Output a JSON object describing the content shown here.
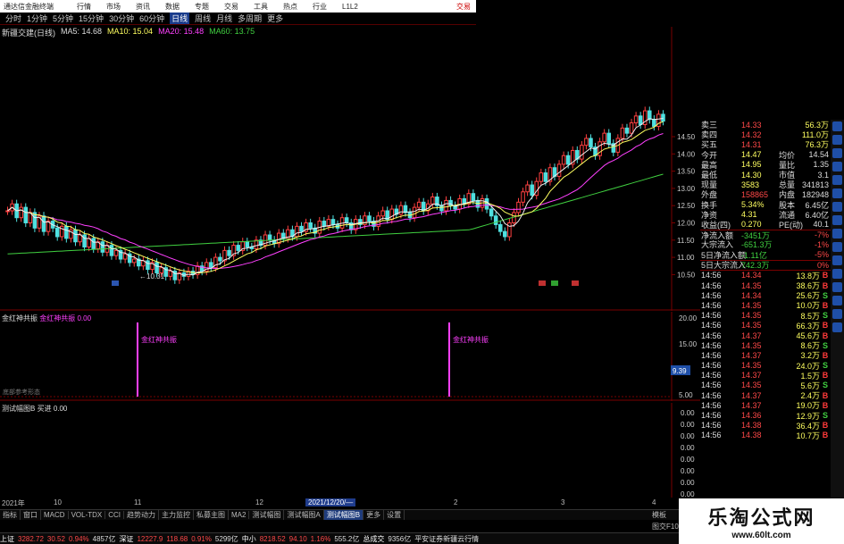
{
  "menubar": {
    "title": "通达信金融终端",
    "items": [
      "行情",
      "市场",
      "资讯",
      "数据",
      "专题",
      "交易",
      "工具",
      "热点",
      "行业",
      "L1L2"
    ],
    "right": "交易"
  },
  "toolbar": {
    "items": [
      "分时",
      "1分钟",
      "5分钟",
      "15分钟",
      "30分钟",
      "60分钟",
      "日线",
      "周线",
      "月线",
      "多周期",
      "更多"
    ],
    "active": "日线"
  },
  "main_chart": {
    "stock_label": "新疆交建(日线)",
    "ma5": "MA5: 14.68",
    "ma10": "MA10: 15.04",
    "ma20": "MA20: 15.48",
    "ma60": "MA60: 13.75",
    "low_label": "←10.31",
    "colors": {
      "up": "#ff4040",
      "down": "#4fe0e0",
      "ma5": "#ffffff",
      "ma10": "#ffff60",
      "ma20": "#ff40ff",
      "ma60": "#40d040"
    },
    "y_ticks": [
      "14.50",
      "14.00",
      "13.50",
      "13.00",
      "12.50",
      "12.00",
      "11.50",
      "11.00",
      "10.50"
    ]
  },
  "ind1": {
    "title": "金红神共振",
    "name2": "金红神共振",
    "value": "0.00",
    "signal_label": "金红神共振",
    "bottom_label": "底部参考形态",
    "y_ticks": [
      "20.00",
      "15.00",
      "9.39",
      "5.00"
    ]
  },
  "ind2": {
    "title": "测试幅图B",
    "name2": "买进",
    "value": "0.00",
    "y_ticks": [
      "0.00",
      "0.00",
      "0.00",
      "0.00",
      "0.00",
      "0.00",
      "0.00",
      "0.00"
    ]
  },
  "dates": {
    "y2021": "2021年",
    "m10": "10",
    "m11": "11",
    "m12": "12",
    "sel": "2021/12/20/—",
    "m1": "2",
    "m2": "3",
    "m3": "4"
  },
  "quote": {
    "sell4": [
      "卖四",
      "14.32",
      "111.0万"
    ],
    "sell3": [
      "卖三",
      "14.33",
      "56.3万"
    ],
    "sell5": [
      "买五",
      "14.31",
      "76.3万"
    ],
    "rows": [
      [
        "今开",
        "14.47",
        "均价",
        "14.54"
      ],
      [
        "最高",
        "14.95",
        "量比",
        "1.35"
      ],
      [
        "最低",
        "14.30",
        "市值",
        "3.1"
      ],
      [
        "现量",
        "3583",
        "总量",
        "341813"
      ],
      [
        "外盘",
        "158865",
        "内盘",
        "182948"
      ],
      [
        "换手",
        "5.34%",
        "股本",
        "6.45亿"
      ],
      [
        "净资",
        "4.31",
        "流通",
        "6.40亿"
      ],
      [
        "收益(四)",
        "0.270",
        "PE(动)",
        "40.1"
      ],
      [
        "净流入额",
        "-3451万",
        "",
        "-7%"
      ],
      [
        "大宗流入",
        "-651.3万",
        "",
        "-1%"
      ],
      [
        "5日净流入额",
        "-1.11亿",
        "",
        "-5%"
      ],
      [
        "5日大宗流入",
        "742.3万",
        "",
        "0%"
      ]
    ]
  },
  "ticks": [
    [
      "14:56",
      "14.34",
      "13.8万",
      "B"
    ],
    [
      "14:56",
      "14.35",
      "38.6万",
      "B"
    ],
    [
      "14:56",
      "14.34",
      "25.6万",
      "S"
    ],
    [
      "14:56",
      "14.35",
      "10.0万",
      "B"
    ],
    [
      "14:56",
      "14.35",
      "8.5万",
      "S"
    ],
    [
      "14:56",
      "14.35",
      "66.3万",
      "B"
    ],
    [
      "14:56",
      "14.37",
      "45.6万",
      "B"
    ],
    [
      "14:56",
      "14.35",
      "8.6万",
      "S"
    ],
    [
      "14:56",
      "14.37",
      "3.2万",
      "B"
    ],
    [
      "14:56",
      "14.35",
      "24.0万",
      "S"
    ],
    [
      "14:56",
      "14.37",
      "1.5万",
      "B"
    ],
    [
      "14:56",
      "14.35",
      "5.6万",
      "S"
    ],
    [
      "14:56",
      "14.37",
      "2.4万",
      "B"
    ],
    [
      "14:56",
      "14.37",
      "19.0万",
      "B"
    ],
    [
      "14:56",
      "14.36",
      "12.9万",
      "S"
    ],
    [
      "14:56",
      "14.38",
      "36.4万",
      "B"
    ],
    [
      "14:56",
      "14.38",
      "10.7万",
      "B"
    ]
  ],
  "tabs": [
    "指标",
    "窗口",
    "MACD",
    "VOL-TDX",
    "CCI",
    "趋势动力",
    "主力监控",
    "私募主图",
    "MA2",
    "测试幅图",
    "测试幅图A",
    "测试幅图B",
    "更多",
    "设置"
  ],
  "active_tab": "测试幅图B",
  "status": {
    "sh": "上证",
    "sh_v": "3282.72",
    "sh_c": "30.52",
    "sh_p": "0.94%",
    "sh_amt": "4857亿",
    "sz": "深证",
    "sz_v": "12227.9",
    "sz_c": "118.68",
    "sz_p": "0.91%",
    "sz_amt": "5299亿",
    "zx": "中小",
    "zx_v": "8218.52",
    "zx_c": "94.10",
    "zx_p": "1.16%",
    "zx_amt": "555.2亿",
    "tot": "总成交",
    "tot_v": "9356亿",
    "news": "平安证券新疆云行情"
  },
  "right_extra": "图交F10",
  "right_misc": "模板",
  "logo": {
    "cn": "乐淘公式网",
    "url": "www.60lt.com"
  }
}
